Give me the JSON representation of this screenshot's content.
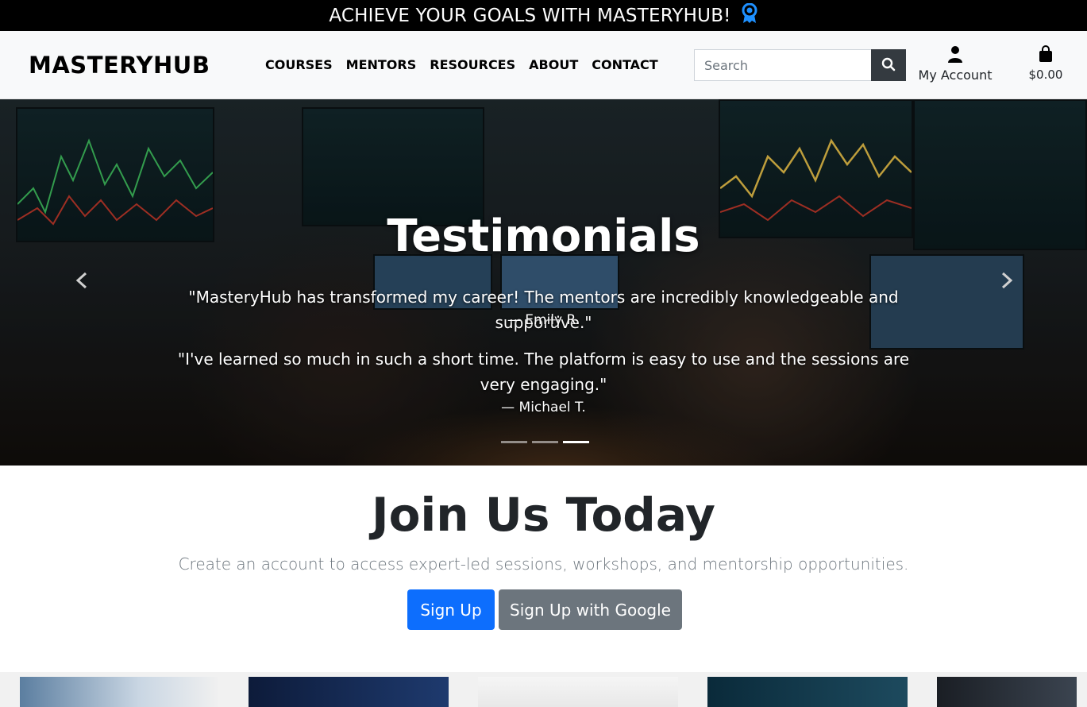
{
  "promo": {
    "text": "ACHIEVE YOUR GOALS WITH MASTERYHUB!",
    "icon": "award-ribbon-icon",
    "icon_color": "#1e90ff"
  },
  "navbar": {
    "brand": "MASTERYHUB",
    "links": [
      "COURSES",
      "MENTORS",
      "RESOURCES",
      "ABOUT",
      "CONTACT"
    ],
    "search_placeholder": "Search",
    "search_value": "",
    "account_label": "My Account",
    "cart_total": "$0.00"
  },
  "hero": {
    "title": "Testimonials",
    "testimonials": [
      {
        "quote": "\"MasteryHub has transformed my career! The mentors are incredibly knowledgeable and supportive.\"",
        "author": "— Emily R."
      },
      {
        "quote": "\"I've learned so much in such a short time. The platform is easy to use and the sessions are very engaging.\"",
        "author": "— Michael T."
      }
    ],
    "slide_count": 3,
    "active_slide": 3
  },
  "join": {
    "title": "Join Us Today",
    "lead": "Create an account to access expert-led sessions, workshops, and mentorship opportunities.",
    "signup_label": "Sign Up",
    "google_label": "Sign Up with Google"
  },
  "colors": {
    "primary": "#0d6efd",
    "secondary": "#6c757d",
    "dark": "#343a40"
  }
}
